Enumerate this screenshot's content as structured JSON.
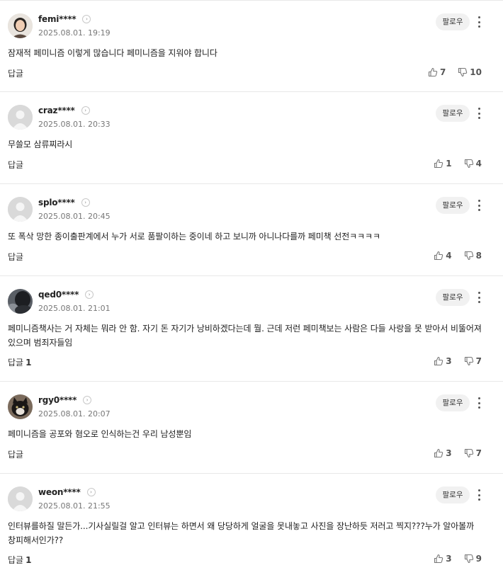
{
  "follow_label": "팔로우",
  "reply_label": "답글",
  "comments": [
    {
      "nickname": "femi****",
      "date": "2025.08.01. 19:19",
      "text": "잠재적 페미니즘 이렇게 많습니다 페미니즘을 지워야 합니다",
      "reply_count": "",
      "likes": "7",
      "dislikes": "10",
      "avatar": "photo-woman"
    },
    {
      "nickname": "craz****",
      "date": "2025.08.01. 20:33",
      "text": "무쓸모 삼류찌라시",
      "reply_count": "",
      "likes": "1",
      "dislikes": "4",
      "avatar": "default"
    },
    {
      "nickname": "splo****",
      "date": "2025.08.01. 20:45",
      "text": "또 폭삭 망한 종이출판계에서 누가 서로 품팔이하는 중이네 하고 보니까 아니나다를까 페미책 선전ㅋㅋㅋㅋ",
      "reply_count": "",
      "likes": "4",
      "dislikes": "8",
      "avatar": "default"
    },
    {
      "nickname": "qed0****",
      "date": "2025.08.01. 21:01",
      "text": "페미니즘책사는 거 자체는 뭐라 안 함. 자기 돈 자기가 낭비하겠다는데 뭘. 근데 저런 페미책보는 사람은 다들 사랑을 못 받아서 비뚤어져있으며 범죄자들임",
      "reply_count": "1",
      "likes": "3",
      "dislikes": "7",
      "avatar": "photo-dark"
    },
    {
      "nickname": "rgy0****",
      "date": "2025.08.01. 20:07",
      "text": "페미니즘을 공포와 혐오로 인식하는건 우리 남성뿐임",
      "reply_count": "",
      "likes": "3",
      "dislikes": "7",
      "avatar": "photo-cat"
    },
    {
      "nickname": "weon****",
      "date": "2025.08.01. 21:55",
      "text": "인터뷰를하질 말든가...기사실릴걸 알고 인터뷰는 하면서 왜 당당하게 얼굴을 못내놓고 사진을 장난하듯 저러고 찍지???누가 알아볼까 창피해서인가??",
      "reply_count": "1",
      "likes": "3",
      "dislikes": "9",
      "avatar": "default"
    }
  ]
}
